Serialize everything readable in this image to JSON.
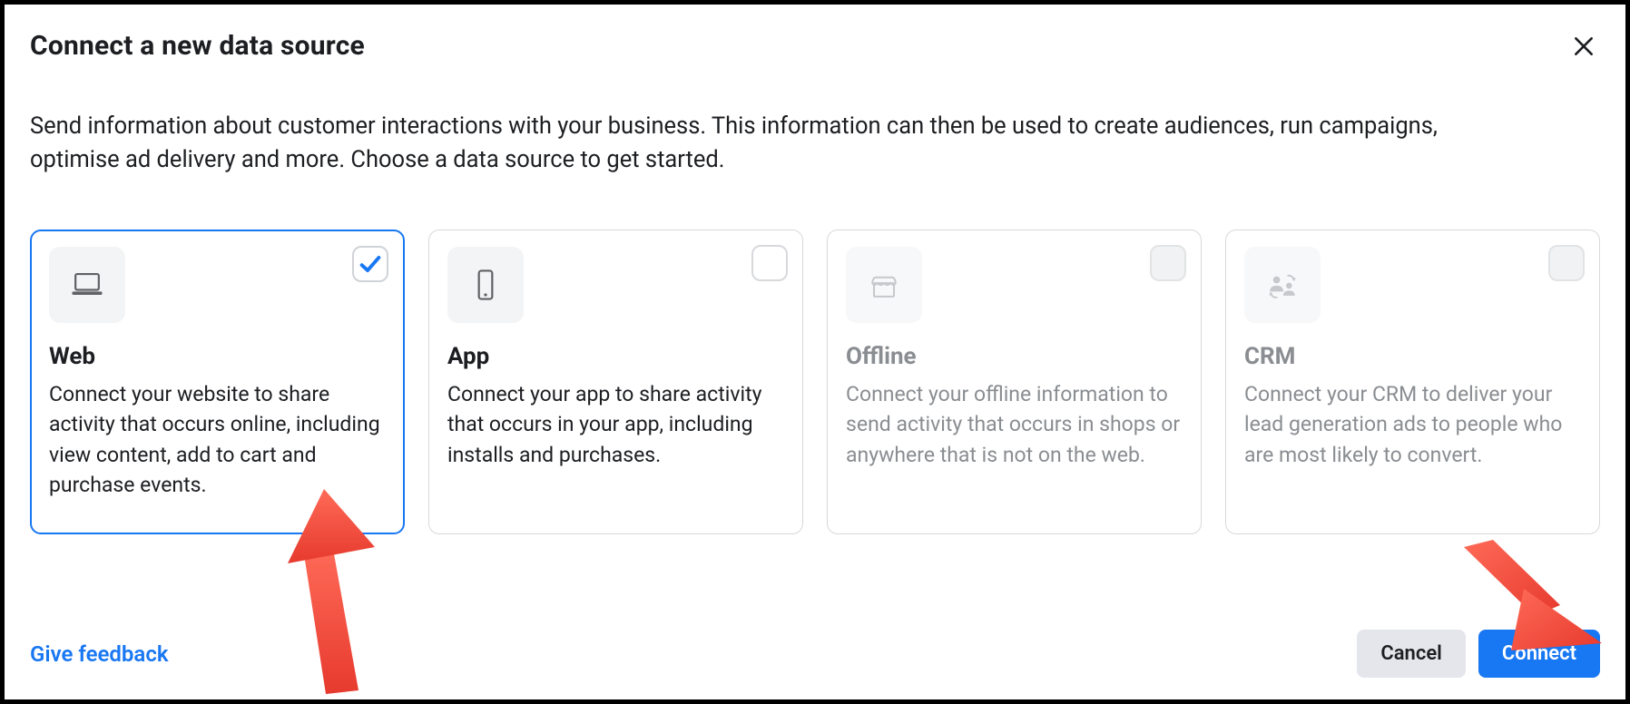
{
  "modal": {
    "title": "Connect a new data source",
    "subtitle": "Send information about customer interactions with your business. This information can then be used to create audiences, run campaigns, optimise ad delivery and more. Choose a data source to get started."
  },
  "options": {
    "web": {
      "title": "Web",
      "desc": "Connect your website to share activity that occurs online, including view content, add to cart and purchase events.",
      "selected": true,
      "enabled": true
    },
    "app": {
      "title": "App",
      "desc": "Connect your app to share activity that occurs in your app, including installs and purchases.",
      "selected": false,
      "enabled": true
    },
    "offline": {
      "title": "Offline",
      "desc": "Connect your offline information to send activity that occurs in shops or anywhere that is not on the web.",
      "selected": false,
      "enabled": false
    },
    "crm": {
      "title": "CRM",
      "desc": "Connect your CRM to deliver your lead generation ads to people who are most likely to convert.",
      "selected": false,
      "enabled": false
    }
  },
  "footer": {
    "feedback": "Give feedback",
    "cancel": "Cancel",
    "connect": "Connect"
  },
  "icons": {
    "close": "close-icon",
    "laptop": "laptop-icon",
    "phone": "phone-icon",
    "store": "store-icon",
    "crm": "crm-icon",
    "check": "check-icon"
  },
  "colors": {
    "primary": "#1877f2",
    "text": "#1c1e21",
    "muted": "#8a8d91",
    "border": "#d7d9dc",
    "arrow": "#ef4b3f"
  }
}
